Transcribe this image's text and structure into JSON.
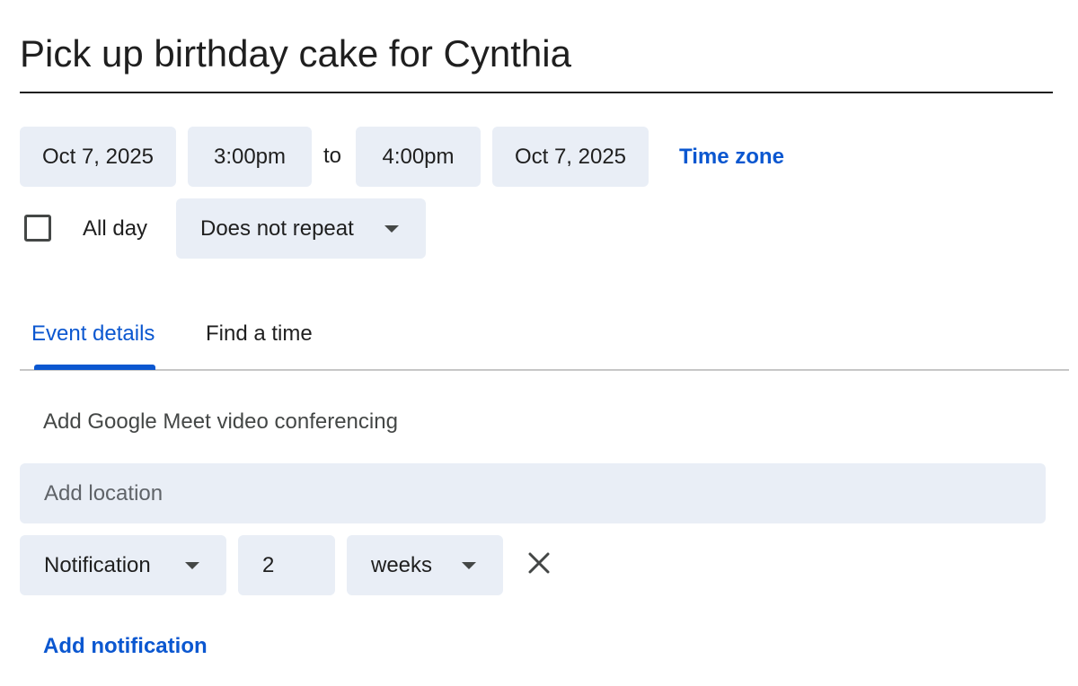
{
  "event": {
    "title": "Pick up birthday cake for Cynthia"
  },
  "datetime": {
    "start_date": "Oct 7, 2025",
    "start_time": "3:00pm",
    "to_label": "to",
    "end_time": "4:00pm",
    "end_date": "Oct 7, 2025",
    "time_zone_link": "Time zone"
  },
  "options": {
    "all_day_label": "All day",
    "all_day_checked": false,
    "repeat_selected": "Does not repeat"
  },
  "tabs": [
    {
      "label": "Event details",
      "active": true
    },
    {
      "label": "Find a time",
      "active": false
    }
  ],
  "details": {
    "meet_label": "Add Google Meet video conferencing",
    "location_placeholder": "Add location",
    "notification": {
      "type_selected": "Notification",
      "amount": "2",
      "unit_selected": "weeks"
    },
    "add_notification_link": "Add notification"
  },
  "colors": {
    "accent": "#0b57d0",
    "field_bg": "#e9eef6",
    "text": "#1f1f1f"
  },
  "icons": {
    "dropdown": "caret-down-icon",
    "remove": "close-icon",
    "checkbox": "checkbox-unchecked-icon"
  }
}
